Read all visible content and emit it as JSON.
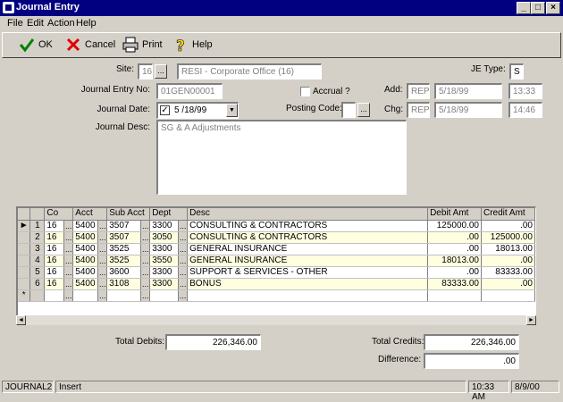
{
  "window": {
    "title": "Journal Entry"
  },
  "menu": [
    "File",
    "Edit",
    "Action",
    "Help"
  ],
  "toolbar": {
    "ok": "OK",
    "cancel": "Cancel",
    "print": "Print",
    "help": "Help"
  },
  "form": {
    "site_label": "Site:",
    "site_code": "16",
    "site_name": "RESI - Corporate Office (16)",
    "je_type_label": "JE Type:",
    "je_type": "S",
    "entry_no_label": "Journal Entry No:",
    "entry_no": "01GEN00001",
    "accrual_label": "Accrual ?",
    "add_label": "Add:",
    "add_user": "REP",
    "add_date": "5/18/99",
    "add_time": "13:33",
    "journal_date_label": "Journal Date:",
    "journal_date": "5 /18/99",
    "posting_code_label": "Posting Code:",
    "posting_code": "",
    "chg_label": "Chg:",
    "chg_user": "REP",
    "chg_date": "5/18/99",
    "chg_time": "14:46",
    "journal_desc_label": "Journal Desc:",
    "journal_desc": "SG & A  Adjustments"
  },
  "grid": {
    "columns": [
      "Co",
      "Acct",
      "Sub Acct",
      "Dept",
      "Desc",
      "Debit Amt",
      "Credit Amt"
    ],
    "rows": [
      {
        "n": "1",
        "co": "16",
        "acct": "5400",
        "sub": "3507",
        "dept": "3300",
        "desc": "CONSULTING & CONTRACTORS",
        "debit": "125000.00",
        "credit": ".00"
      },
      {
        "n": "2",
        "co": "16",
        "acct": "5400",
        "sub": "3507",
        "dept": "3050",
        "desc": "CONSULTING & CONTRACTORS",
        "debit": ".00",
        "credit": "125000.00"
      },
      {
        "n": "3",
        "co": "16",
        "acct": "5400",
        "sub": "3525",
        "dept": "3300",
        "desc": "GENERAL INSURANCE",
        "debit": ".00",
        "credit": "18013.00"
      },
      {
        "n": "4",
        "co": "16",
        "acct": "5400",
        "sub": "3525",
        "dept": "3550",
        "desc": "GENERAL INSURANCE",
        "debit": "18013.00",
        "credit": ".00"
      },
      {
        "n": "5",
        "co": "16",
        "acct": "5400",
        "sub": "3600",
        "dept": "3300",
        "desc": "SUPPORT & SERVICES - OTHER",
        "debit": ".00",
        "credit": "83333.00"
      },
      {
        "n": "6",
        "co": "16",
        "acct": "5400",
        "sub": "3108",
        "dept": "3300",
        "desc": "BONUS",
        "debit": "83333.00",
        "credit": ".00"
      }
    ],
    "new_row_marker": "*"
  },
  "totals": {
    "debits_label": "Total Debits:",
    "debits": "226,346.00",
    "credits_label": "Total Credits:",
    "credits": "226,346.00",
    "difference_label": "Difference:",
    "difference": ".00"
  },
  "status": {
    "form": "JOURNAL2",
    "mode": "Insert",
    "time": "10:33 AM",
    "date": "8/9/00"
  },
  "colors": {
    "title_bar": "#000080",
    "row_highlight": "#ffffe0",
    "face": "#d4d0c8"
  }
}
